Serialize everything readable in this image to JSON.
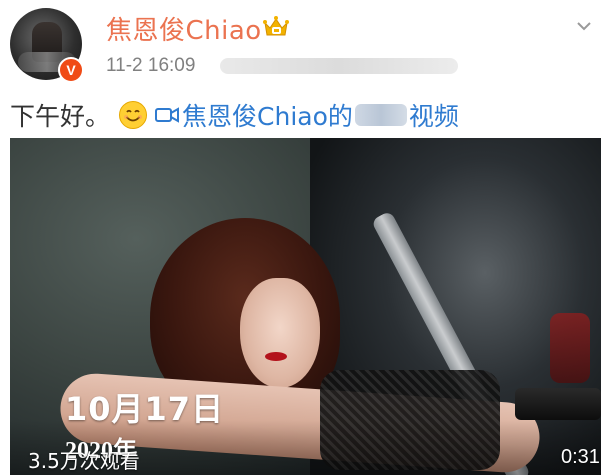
{
  "post": {
    "author": {
      "name": "焦恩俊Chiao",
      "verified_badge": "V",
      "crown_icon": "crown-icon",
      "verified_color": "#f04b16",
      "name_color": "#eb7350"
    },
    "timestamp": "11-2 16:09",
    "text": {
      "greeting": "下午好。",
      "emoji": "smiley-emoji",
      "video_link_author": "焦恩俊Chiao的",
      "video_link_suffix": "视频",
      "link_color": "#2f7bd0"
    },
    "video": {
      "date_overlay": "10月17日",
      "year_overlay": "2020年",
      "views": "3.5万次观看",
      "duration": "0:31"
    }
  }
}
